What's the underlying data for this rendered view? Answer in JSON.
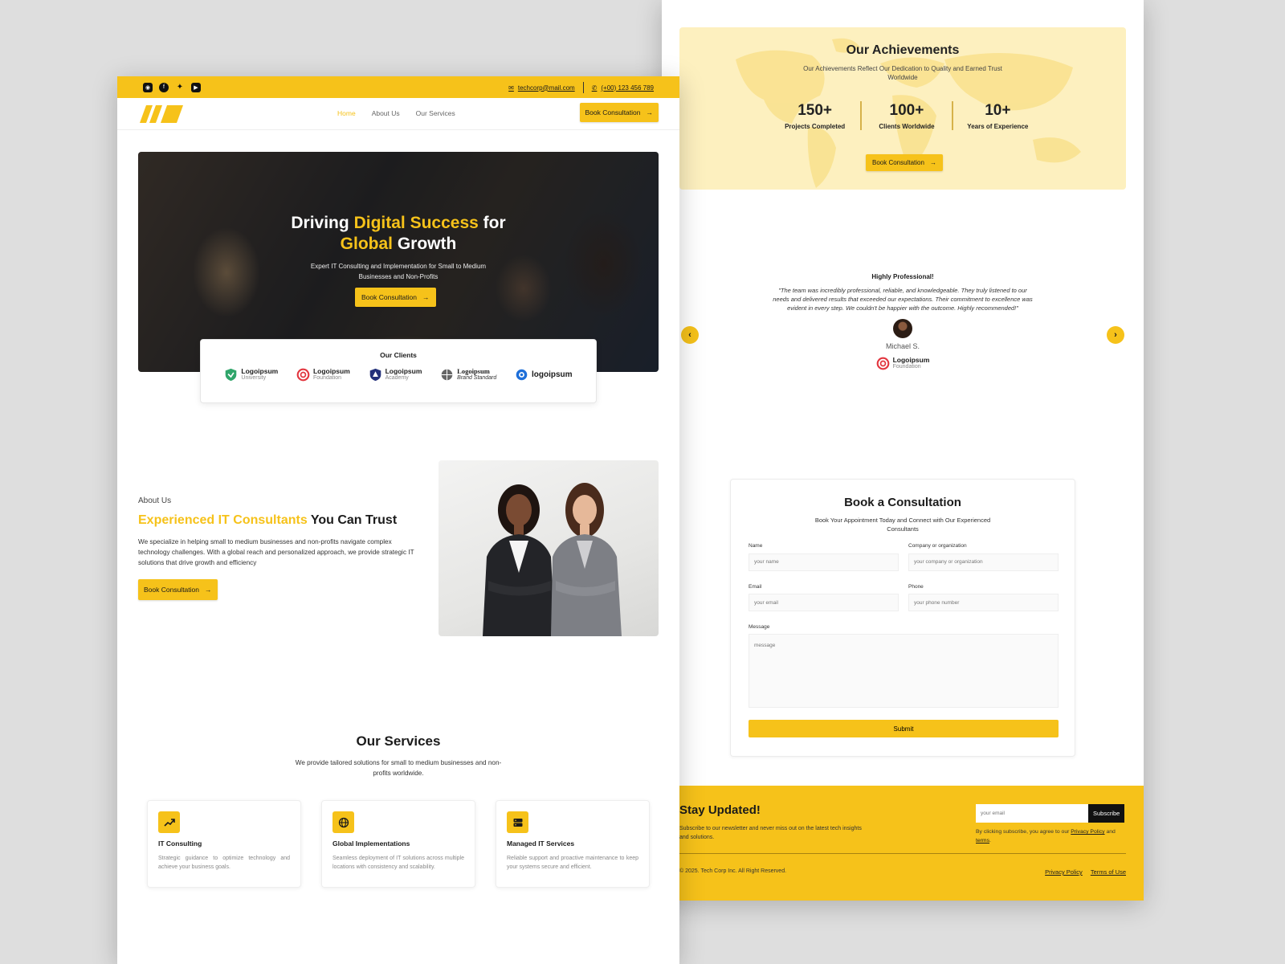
{
  "colors": {
    "accent": "#f6c21a",
    "dark": "#1b1b1b"
  },
  "topbar": {
    "social_icons": [
      "instagram-icon",
      "facebook-icon",
      "twitter-icon",
      "youtube-icon"
    ],
    "email": "techcorp@mail.com",
    "phone": "(+00) 123 456 789"
  },
  "nav": {
    "links": [
      "Home",
      "About Us",
      "Our Services"
    ],
    "active": "Home",
    "cta": "Book Consultation"
  },
  "hero": {
    "title_part1": "Driving ",
    "title_highlight1": "Digital Success",
    "title_part2": " for",
    "title_highlight2": "Global",
    "title_part3": " Growth",
    "subtitle": "Expert IT Consulting and Implementation for Small to Medium Businesses and Non-Profits",
    "cta": "Book Consultation"
  },
  "clients": {
    "title": "Our Clients",
    "logos": [
      {
        "name": "Logoipsum",
        "tag": "University",
        "color": "#2fa56a"
      },
      {
        "name": "Logoipsum",
        "tag": "Foundation",
        "color": "#e2363f"
      },
      {
        "name": "Logoipsum",
        "tag": "Academy",
        "color": "#23307a"
      },
      {
        "name": "Logoipsum",
        "tag": "Brand Standard",
        "color": "#555555"
      },
      {
        "name": "logoipsum",
        "tag": "",
        "color": "#1e6fd9"
      }
    ]
  },
  "about": {
    "label": "About Us",
    "title_highlight": "Experienced IT Consultants",
    "title_rest": " You Can Trust",
    "body": "We specialize in helping small to medium businesses and non-profits navigate complex technology challenges. With a global reach and personalized approach, we provide strategic IT solutions that drive growth and efficiency",
    "cta": "Book Consultation"
  },
  "services": {
    "title": "Our Services",
    "subtitle": "We provide tailored solutions for small to medium businesses and non-profits worldwide.",
    "items": [
      {
        "icon": "trending-up-icon",
        "title": "IT Consulting",
        "desc": "Strategic guidance to optimize technology and achieve your business goals."
      },
      {
        "icon": "globe-icon",
        "title": "Global Implementations",
        "desc": "Seamless deployment of IT solutions across multiple locations with consistency and scalability."
      },
      {
        "icon": "server-icon",
        "title": "Managed IT Services",
        "desc": "Reliable support and proactive maintenance to keep your systems secure and efficient."
      }
    ]
  },
  "achievements": {
    "title": "Our Achievements",
    "subtitle": "Our Achievements Reflect Our Dedication to Quality and Earned Trust Worldwide",
    "stats": [
      {
        "value": "150+",
        "label": "Projects Completed"
      },
      {
        "value": "100+",
        "label": "Clients Worldwide"
      },
      {
        "value": "10+",
        "label": "Years of Experience"
      }
    ],
    "cta": "Book Consultation"
  },
  "testimonial": {
    "title": "Highly Professional!",
    "quote": "\"The team was incredibly professional, reliable, and knowledgeable. They truly listened to our needs and delivered results that exceeded our expectations. Their commitment to excellence was evident in every step. We couldn't be happier with the outcome. Highly recommended!\"",
    "author": "Michael S.",
    "company_name": "Logoipsum",
    "company_tag": "Foundation"
  },
  "booking": {
    "title": "Book a Consultation",
    "subtitle": "Book Your Appointment Today and Connect with Our Experienced Consultants",
    "fields": {
      "name_label": "Name",
      "name_placeholder": "your name",
      "company_label": "Company or organization",
      "company_placeholder": "your company or organization",
      "email_label": "Email",
      "email_placeholder": "your email",
      "phone_label": "Phone",
      "phone_placeholder": "your phone number",
      "message_label": "Message",
      "message_placeholder": "message"
    },
    "submit": "Submit"
  },
  "footer": {
    "title": "Stay Updated!",
    "subtitle": "Subscribe to our newsletter and never miss out on the latest tech insights and solutions.",
    "email_placeholder": "your email",
    "subscribe": "Subscribe",
    "agree_pre": "By clicking subscribe, you agree to our ",
    "agree_link1": "Privacy Policy",
    "agree_mid": " and ",
    "agree_link2": "terms",
    "agree_end": ".",
    "copyright": "© 2025. Tech Corp Inc. All Right Reserved.",
    "links": [
      "Privacy Policy",
      "Terms of Use"
    ]
  }
}
